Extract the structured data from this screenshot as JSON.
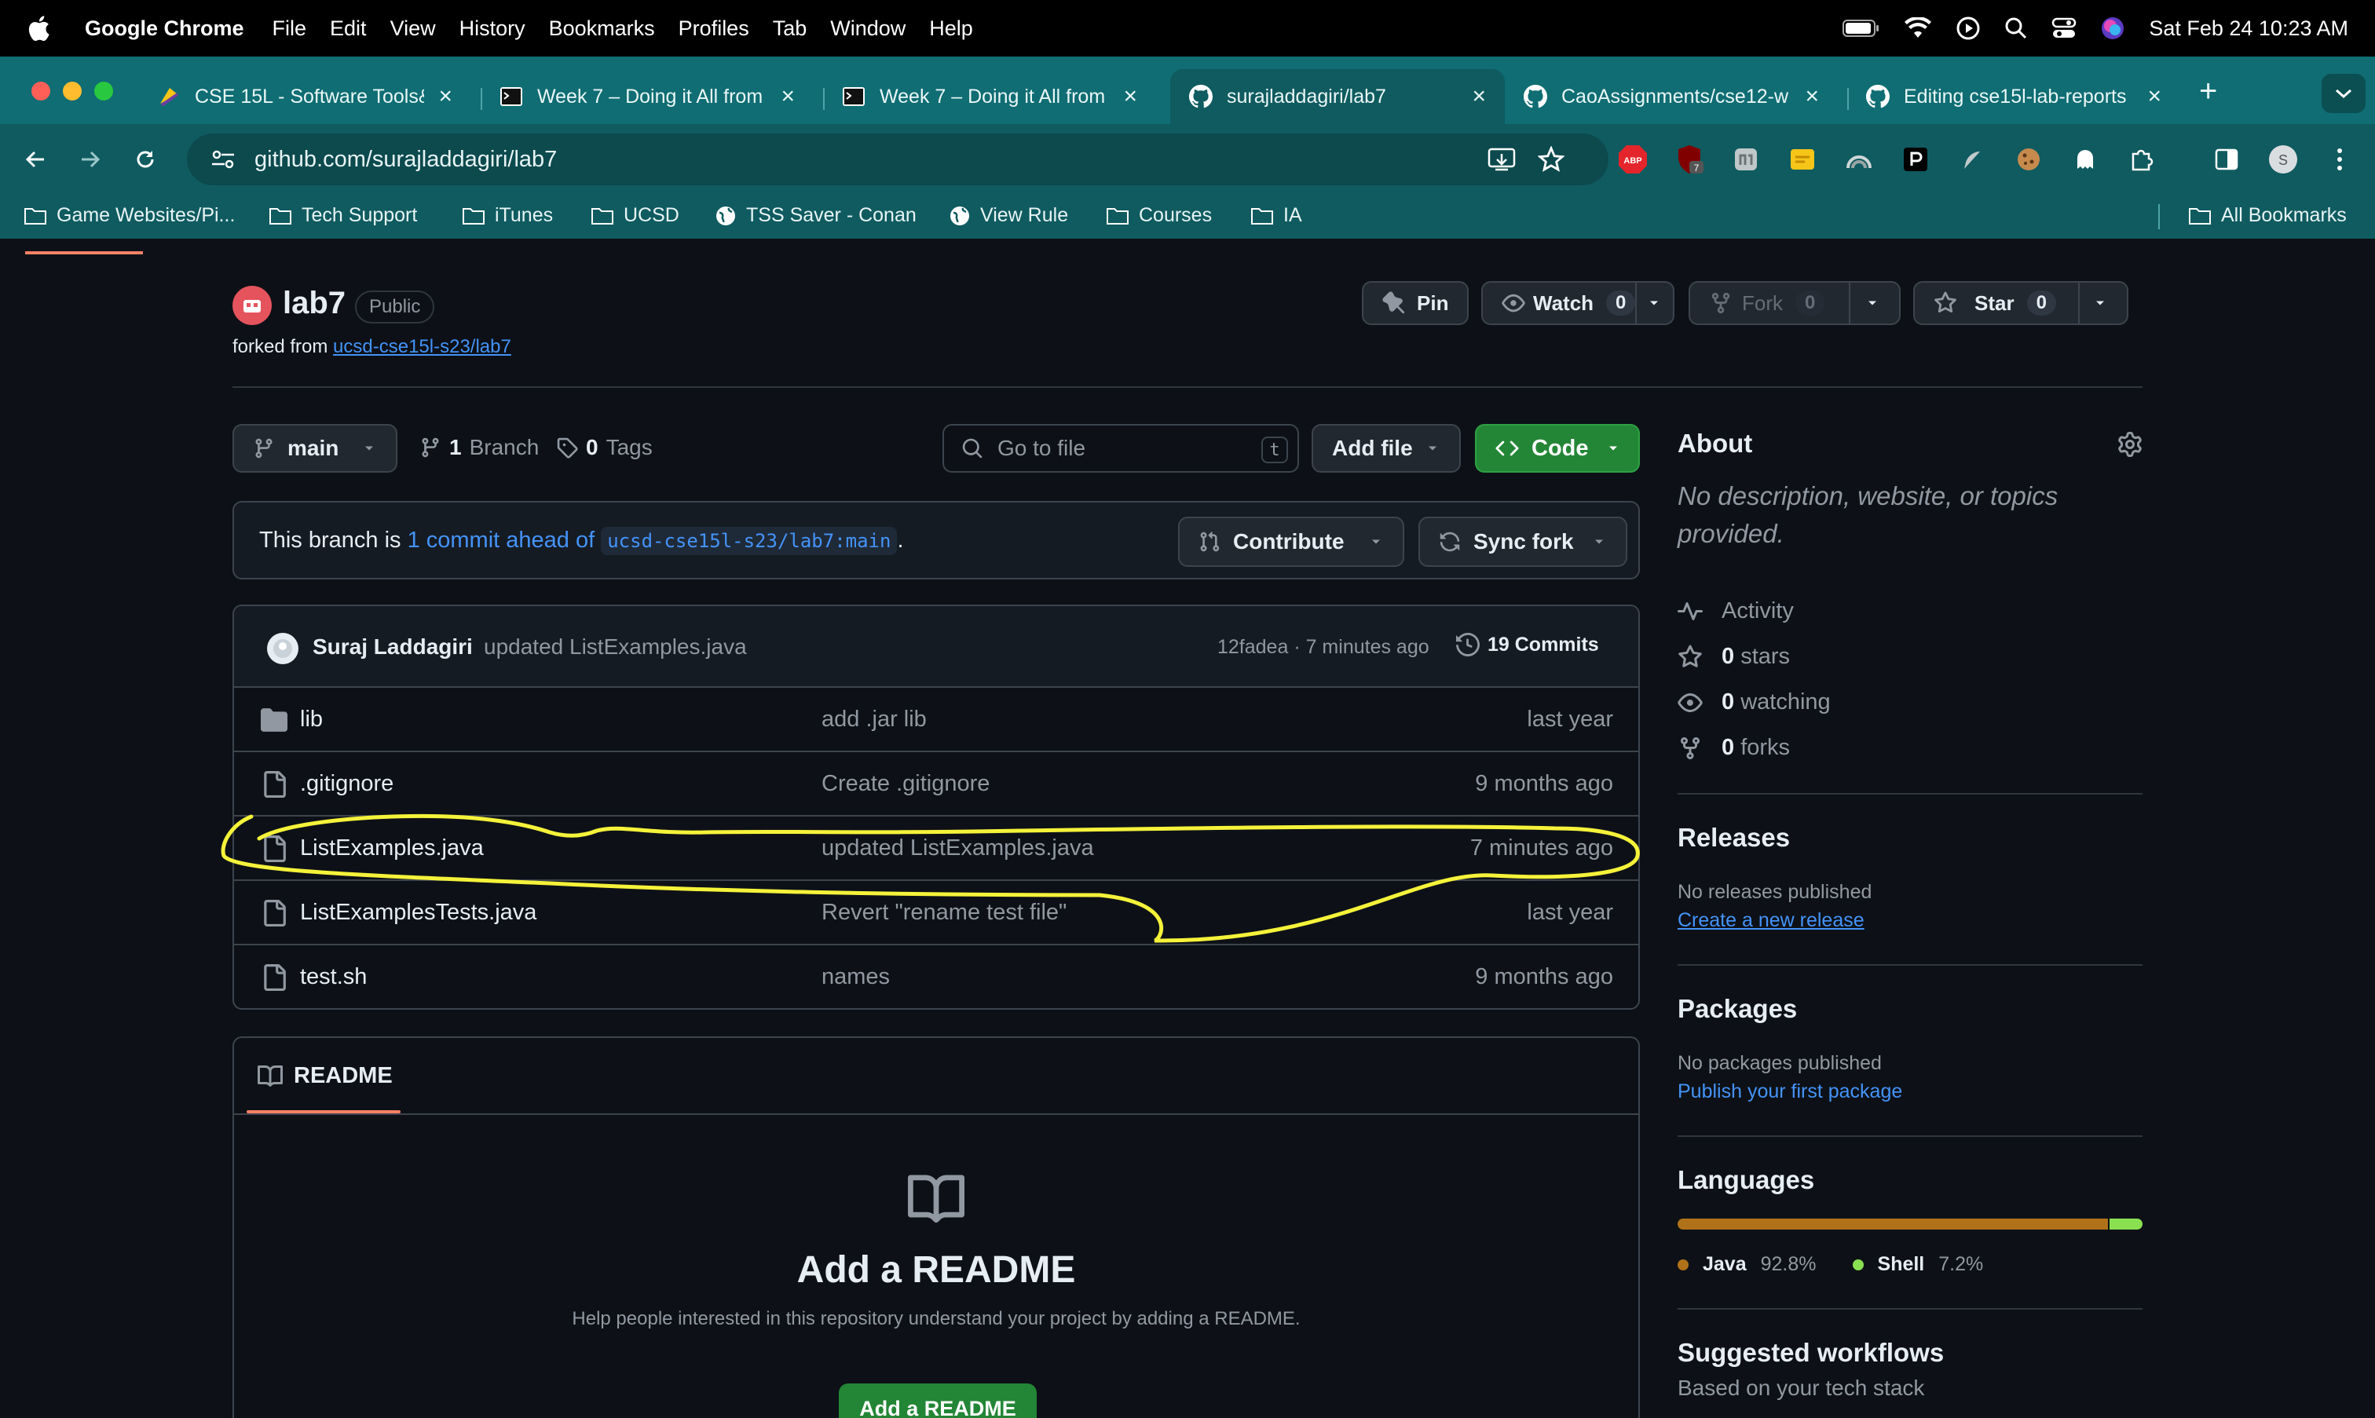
{
  "menubar": {
    "app": "Google Chrome",
    "items": [
      "File",
      "Edit",
      "View",
      "History",
      "Bookmarks",
      "Profiles",
      "Tab",
      "Window",
      "Help"
    ],
    "datetime": "Sat Feb 24  10:23 AM"
  },
  "tabs": [
    {
      "title": "CSE 15L - Software Tools&",
      "favicon": "canvas-icon"
    },
    {
      "title": "Week 7 – Doing it All from",
      "favicon": "terminal-icon"
    },
    {
      "title": "Week 7 – Doing it All from",
      "favicon": "terminal-icon"
    },
    {
      "title": "surajladdagiri/lab7",
      "favicon": "github-icon",
      "active": true
    },
    {
      "title": "CaoAssignments/cse12-w",
      "favicon": "github-icon"
    },
    {
      "title": "Editing cse15l-lab-reports",
      "favicon": "github-icon"
    }
  ],
  "toolbar": {
    "url": "github.com/surajladdagiri/lab7"
  },
  "extensions": {
    "abp": "ABP",
    "badge_count": "7"
  },
  "bookmarks": [
    {
      "label": "Game Websites/Pi...",
      "icon": "folder-icon"
    },
    {
      "label": "Tech Support",
      "icon": "folder-icon"
    },
    {
      "label": "iTunes",
      "icon": "folder-icon"
    },
    {
      "label": "UCSD",
      "icon": "folder-icon"
    },
    {
      "label": "TSS Saver - Conan",
      "icon": "globe-icon"
    },
    {
      "label": "View Rule",
      "icon": "globe-icon"
    },
    {
      "label": "Courses",
      "icon": "folder-icon"
    },
    {
      "label": "IA",
      "icon": "folder-icon"
    }
  ],
  "all_bookmarks": "All Bookmarks",
  "repo": {
    "name": "lab7",
    "visibility": "Public",
    "forked_prefix": "forked from",
    "forked_from": "ucsd-cse15l-s23/lab7",
    "pin": "Pin",
    "watch": "Watch",
    "watch_count": "0",
    "fork": "Fork",
    "fork_count": "0",
    "star": "Star",
    "star_count": "0"
  },
  "branch_bar": {
    "branch": "main",
    "branches_count": "1",
    "branches_label": "Branch",
    "tags_count": "0",
    "tags_label": "Tags",
    "search_placeholder": "Go to file",
    "search_key": "t",
    "add_file": "Add file",
    "code": "Code"
  },
  "ahead": {
    "prefix": "This branch is",
    "link": "1 commit ahead of",
    "ref": "ucsd-cse15l-s23/lab7:main",
    "suffix": ".",
    "contribute": "Contribute",
    "sync": "Sync fork"
  },
  "latest_commit": {
    "author": "Suraj Laddagiri",
    "message": "updated ListExamples.java",
    "meta": "12fadea · 7 minutes ago",
    "count": "19 Commits"
  },
  "files": [
    {
      "name": "lib",
      "type": "folder",
      "message": "add .jar lib",
      "date": "last year"
    },
    {
      "name": ".gitignore",
      "type": "file",
      "message": "Create .gitignore",
      "date": "9 months ago"
    },
    {
      "name": "ListExamples.java",
      "type": "file",
      "message": "updated ListExamples.java",
      "date": "7 minutes ago"
    },
    {
      "name": "ListExamplesTests.java",
      "type": "file",
      "message": "Revert \"rename test file\"",
      "date": "last year"
    },
    {
      "name": "test.sh",
      "type": "file",
      "message": "names",
      "date": "9 months ago"
    }
  ],
  "readme": {
    "tab": "README",
    "title": "Add a README",
    "description": "Help people interested in this repository understand your project by adding a README.",
    "button": "Add a README"
  },
  "sidebar": {
    "about": "About",
    "description": "No description, website, or topics provided.",
    "activity": "Activity",
    "stars_count": "0",
    "stars_label": "stars",
    "watching_count": "0",
    "watching_label": "watching",
    "forks_count": "0",
    "forks_label": "forks",
    "releases": "Releases",
    "releases_none": "No releases published",
    "releases_link": "Create a new release",
    "packages": "Packages",
    "packages_none": "No packages published",
    "packages_link": "Publish your first package",
    "languages": "Languages",
    "langs": [
      {
        "name": "Java",
        "pct": "92.8%",
        "value": 92.8,
        "color": "#b07219"
      },
      {
        "name": "Shell",
        "pct": "7.2%",
        "value": 7.2,
        "color": "#89e051"
      }
    ],
    "workflows": "Suggested workflows",
    "workflows_sub": "Based on your tech stack"
  },
  "colors": {
    "annotation": "#f5f23a",
    "accent": "#238636",
    "link": "#4493f8"
  }
}
